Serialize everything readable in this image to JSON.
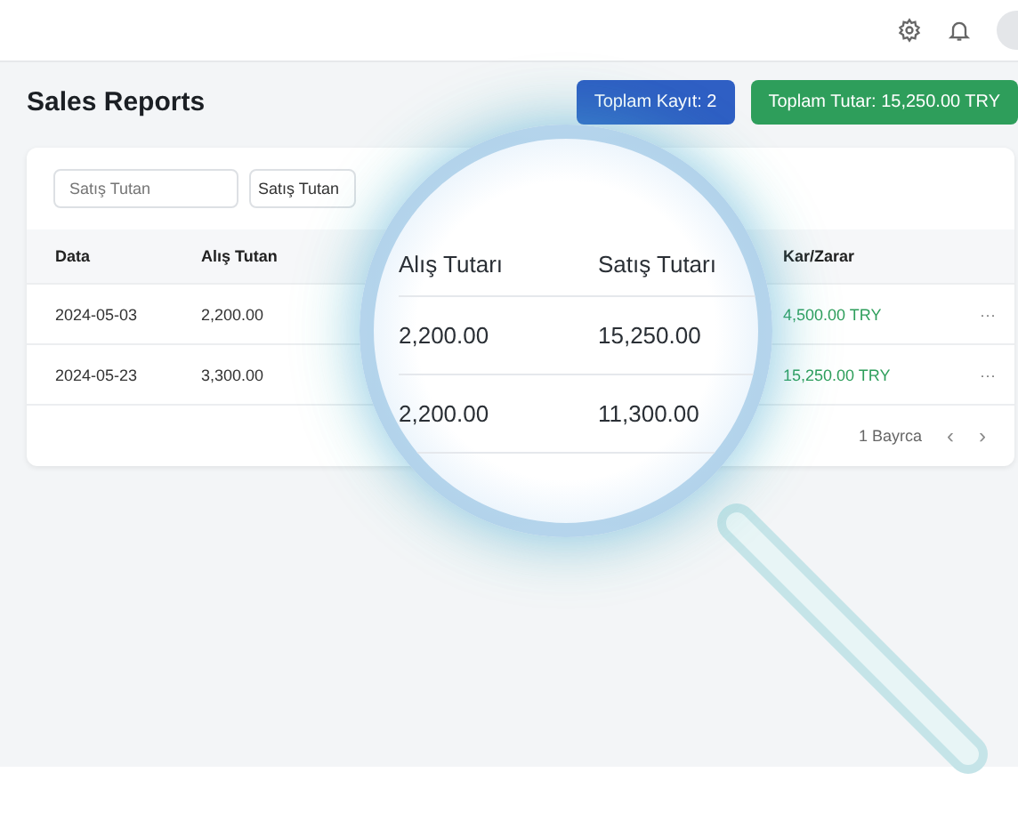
{
  "title": "Sales Reports",
  "badges": [
    {
      "label": "Toplam Kayıt: 2",
      "color": "#2f5fc4"
    },
    {
      "label": "Toplam Tutar: 15,250.00 TRY",
      "color": "#2e9e5b"
    }
  ],
  "filters": [
    {
      "placeholder": "Satış Tutan"
    },
    {
      "value": "Satış Tutan"
    }
  ],
  "table": {
    "columns": [
      "Data",
      "Alış Tutan",
      "Kar/Zarar"
    ],
    "rows": [
      [
        "2024-05-03",
        "2,200.00",
        "4,500.00 TRY"
      ],
      [
        "2024-05-23",
        "3,300.00",
        "15,250.00 TRY"
      ]
    ],
    "row_action": "···",
    "footer": "1 Bayrca",
    "prev": "‹",
    "next": "›"
  },
  "magnifier": {
    "columns": [
      "Alış Tutarı",
      "Satış Tutarı"
    ],
    "rows": [
      [
        "2,200.00",
        "15,250.00"
      ],
      [
        "2,200.00",
        "11,300.00"
      ]
    ]
  }
}
